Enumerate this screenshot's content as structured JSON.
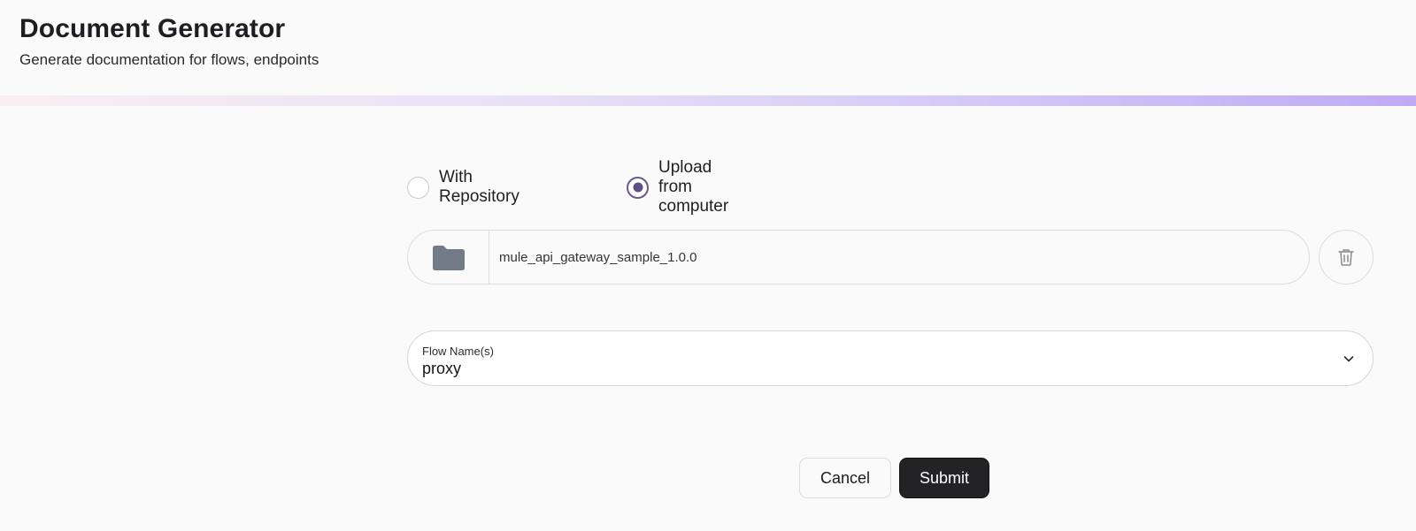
{
  "header": {
    "title": "Document Generator",
    "subtitle": "Generate documentation for flows, endpoints"
  },
  "source": {
    "options": [
      {
        "label": "With Repository",
        "selected": false
      },
      {
        "label": "Upload from computer",
        "selected": true
      }
    ]
  },
  "upload": {
    "file_name": "mule_api_gateway_sample_1.0.0",
    "folder_icon": "folder-icon",
    "delete_icon": "trash-icon"
  },
  "flow": {
    "label": "Flow Name(s)",
    "value": "proxy",
    "icon": "chevron-down-icon"
  },
  "actions": {
    "cancel_label": "Cancel",
    "submit_label": "Submit"
  },
  "colors": {
    "accent": "#5e4f86",
    "submit_bg": "#232325",
    "gradient_start": "#fbeef3",
    "gradient_end": "#bfaaf4"
  }
}
